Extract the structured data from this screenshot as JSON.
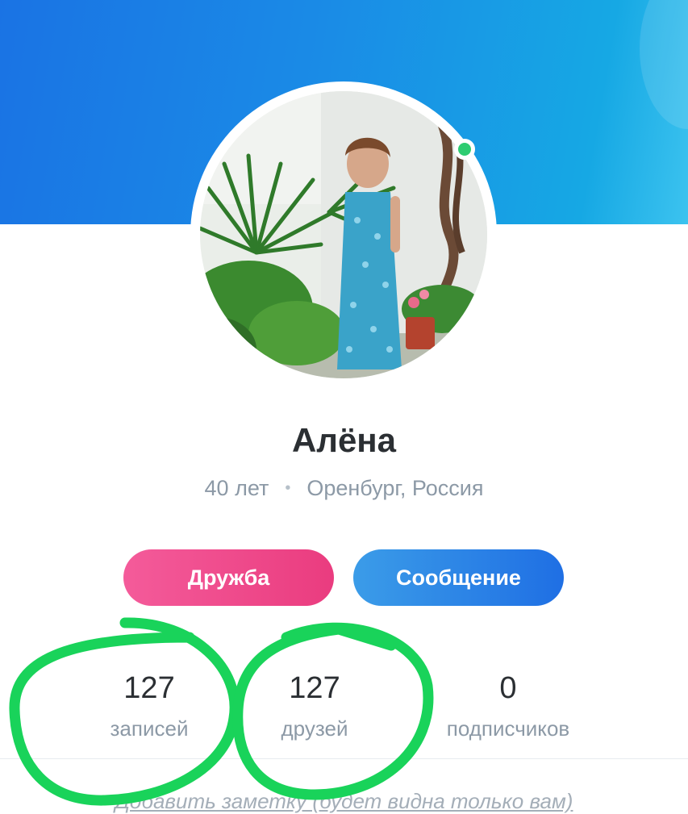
{
  "profile": {
    "name": "Алёна",
    "age": "40 лет",
    "separator": "•",
    "location": "Оренбург, Россия",
    "online": true
  },
  "actions": {
    "friend_label": "Дружба",
    "message_label": "Сообщение"
  },
  "stats": [
    {
      "value": "127",
      "label": "записей"
    },
    {
      "value": "127",
      "label": "друзей"
    },
    {
      "value": "0",
      "label": "подписчиков"
    }
  ],
  "note": {
    "text": "Добавить заметку (будет видна только вам)"
  },
  "colors": {
    "cover_start": "#1a73e4",
    "cover_end": "#16a8e4",
    "online": "#2ecc71",
    "friend_button": "#ea3c7f",
    "message_button": "#1f6fe4",
    "annotation": "#19d35a"
  }
}
